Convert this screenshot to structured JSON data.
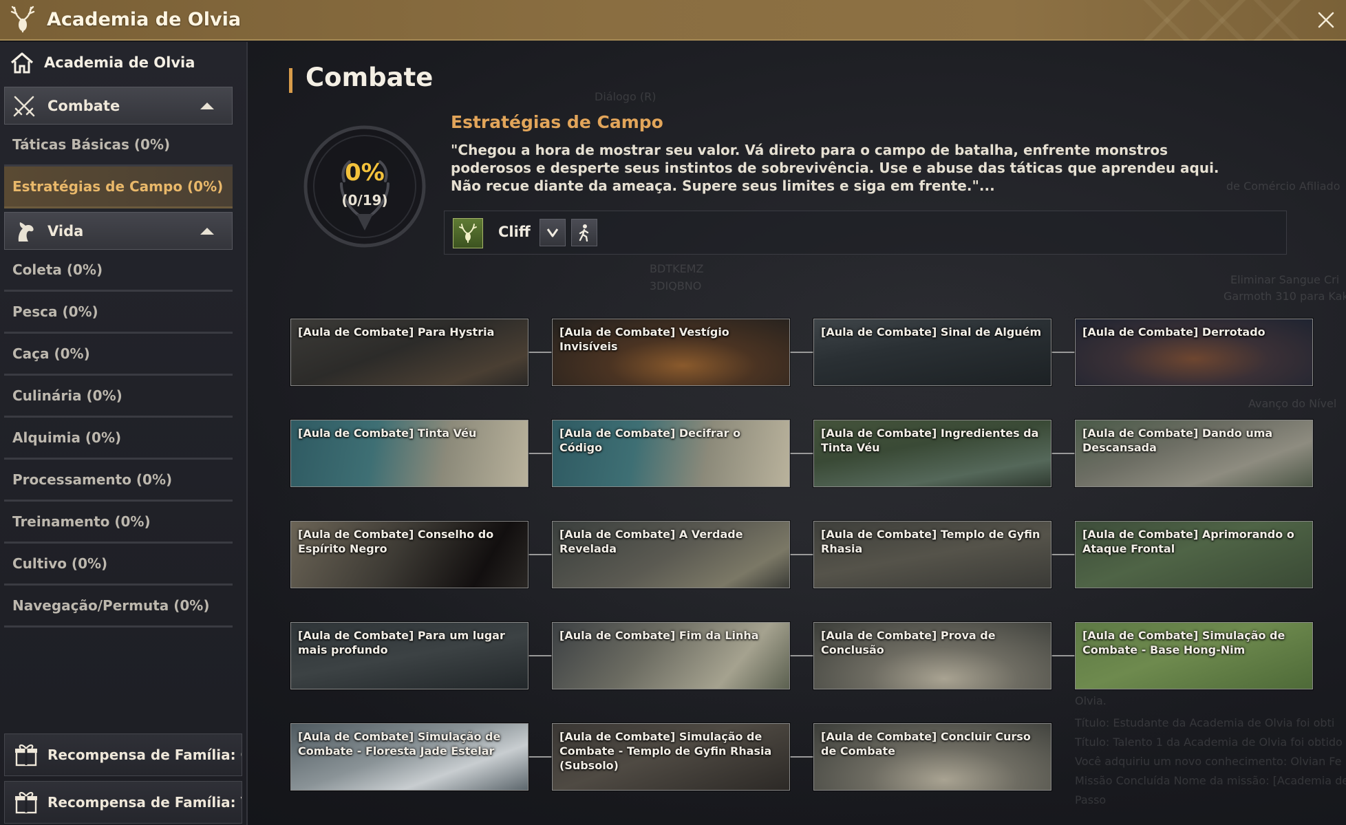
{
  "window": {
    "title": "Academia de Olvia"
  },
  "sidebar": {
    "home_label": "Academia de Olvia",
    "categories": [
      {
        "label": "Combate",
        "items": [
          "Táticas Básicas (0%)",
          "Estratégias de Campo (0%)"
        ]
      },
      {
        "label": "Vida",
        "items": [
          "Coleta (0%)",
          "Pesca (0%)",
          "Caça (0%)",
          "Culinária (0%)",
          "Alquimia (0%)",
          "Processamento (0%)",
          "Treinamento (0%)",
          "Cultivo (0%)",
          "Navegação/Permuta (0%)"
        ]
      }
    ],
    "rewards": [
      "Recompensa de Família: Co...",
      "Recompensa de Família: Vida"
    ]
  },
  "main": {
    "section_title": "Combate",
    "progress": {
      "percent_text": "0%",
      "count_text": "(0/19)",
      "fraction": 0
    },
    "strategy_title": "Estratégias de Campo",
    "strategy_desc": "\"Chegou a hora de mostrar seu valor. Vá direto para o campo de batalha, enfrente monstros poderosos e desperte seus instintos de sobrevivência. Use e abuse das táticas que aprendeu aqui. Não recue diante da ameaça. Supere seus limites e siga em frente.\"...",
    "npc_name": "Cliff",
    "background_text": [
      "Diálogo (R)",
      "BDTKEMZ",
      "3DIQBNO",
      "de Comércio Afiliado",
      "Eliminar Sangue Cri",
      "Garmoth 310 para Kak",
      "Avanço do Nível",
      "Olvia.",
      "Título: Estudante da Academia de Olvia foi obti",
      "Título: Talento 1 da Academia de Olvia foi obtido",
      "Você adquiriu um novo conhecimento: Olvian Fe",
      "Missão Concluída Nome da missão: [Academia de",
      "Passo"
    ],
    "quests": [
      "[Aula de Combate] Para Hystria",
      "[Aula de Combate] Vestígio Invisíveis",
      "[Aula de Combate] Sinal de Alguém",
      "[Aula de Combate] Derrotado",
      "[Aula de Combate] Tinta Véu",
      "[Aula de Combate] Decifrar o Código",
      "[Aula de Combate] Ingredientes da Tinta Véu",
      "[Aula de Combate] Dando uma Descansada",
      "[Aula de Combate] Conselho do Espírito Negro",
      "[Aula de Combate] A Verdade Revelada",
      "[Aula de Combate] Templo de Gyfin Rhasia",
      "[Aula de Combate] Aprimorando o Ataque Frontal",
      "[Aula de Combate] Para um lugar mais profundo",
      "[Aula de Combate] Fim da Linha",
      "[Aula de Combate] Prova de Conclusão",
      "[Aula de Combate] Simulação de Combate - Base Hong-Nim",
      "[Aula de Combate] Simulação de Combate - Floresta Jade Estelar",
      "[Aula de Combate] Simulação de Combate - Templo de Gyfin Rhasia (Subsolo)",
      "[Aula de Combate] Concluir Curso de Combate"
    ]
  },
  "colors": {
    "title_bar": "#8a6e41",
    "accent_orange": "#e2a55a",
    "progress_gold": "#f3c23c",
    "active_item": "#e9b86a"
  },
  "icons": {
    "title": "deer-antler-icon",
    "close": "close-icon",
    "home": "home-icon",
    "combat": "crossed-swords-icon",
    "life": "horse-head-icon",
    "reward": "gift-box-icon",
    "npc": "npc-portrait-icon",
    "dropdown": "chevron-down-icon",
    "navigate": "walking-person-icon"
  }
}
